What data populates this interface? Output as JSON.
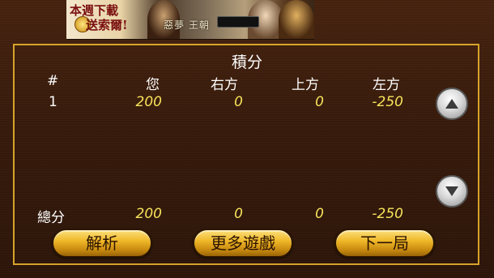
{
  "banner": {
    "promo_line1": "本週下載",
    "promo_line2": "送索爾!",
    "game_title": "惡夢 王朝"
  },
  "scoreboard": {
    "title": "積分",
    "headers": [
      "#",
      "您",
      "右方",
      "上方",
      "左方"
    ],
    "rows": [
      {
        "round": "1",
        "you": "200",
        "right": "0",
        "top": "0",
        "left": "-250"
      }
    ],
    "total": {
      "label": "總分",
      "you": "200",
      "right": "0",
      "top": "0",
      "left": "-250"
    }
  },
  "buttons": {
    "analysis": "解析",
    "more_games": "更多遊戲",
    "next_round": "下一局"
  },
  "icons": {
    "scroll_up": "triangle-up-icon",
    "scroll_down": "triangle-down-icon"
  },
  "colors": {
    "accent_gold": "#d6a32a",
    "score_yellow": "#f6e25a"
  }
}
